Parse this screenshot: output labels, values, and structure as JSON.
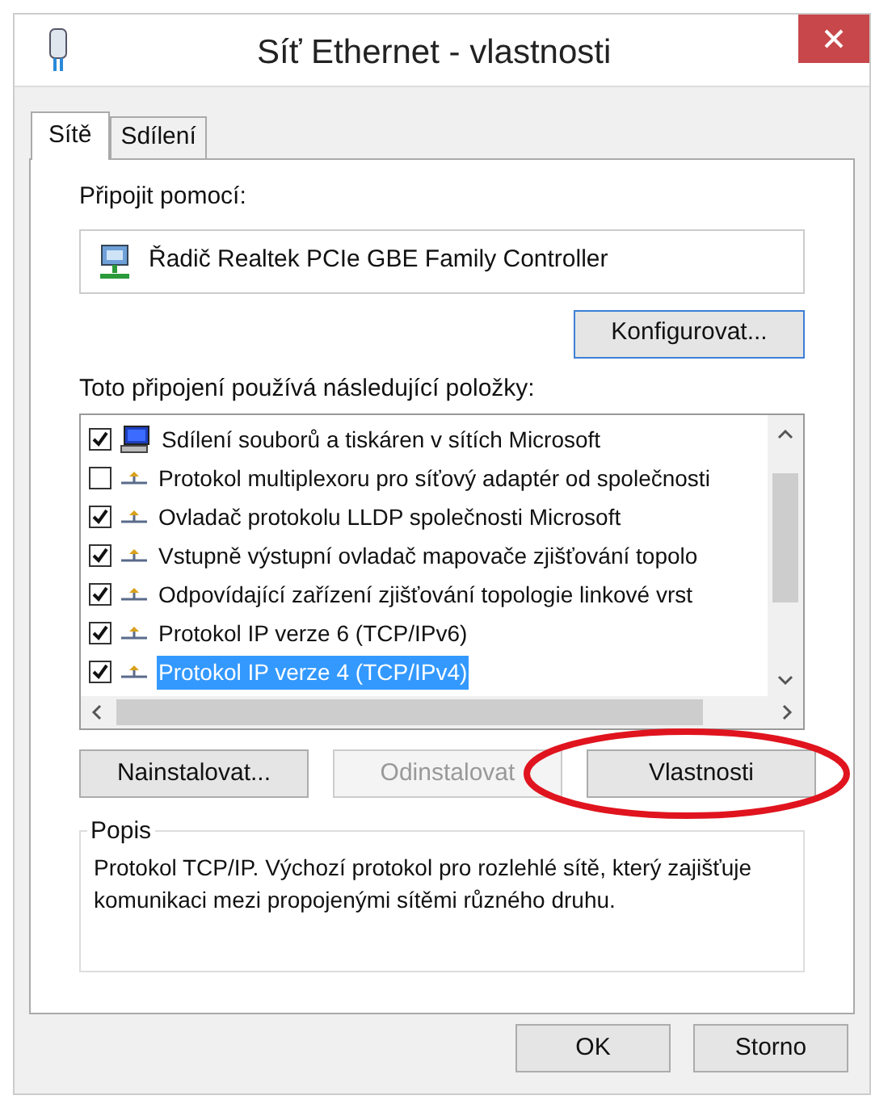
{
  "window": {
    "title": "Síť Ethernet - vlastnosti"
  },
  "tabs": [
    {
      "label": "Sítě",
      "selected": true
    },
    {
      "label": "Sdílení",
      "selected": false
    }
  ],
  "connect_using": {
    "label": "Připojit pomocí:",
    "adapter": "Řadič Realtek PCIe GBE Family Controller",
    "button": "Konfigurovat..."
  },
  "items_label": "Toto připojení používá následující položky:",
  "items": [
    {
      "kind": "service",
      "label": "Sdílení souborů a tiskáren v sítích Microsoft",
      "checked": true,
      "selected": false
    },
    {
      "kind": "protocol",
      "label": "Protokol multiplexoru pro síťový adaptér od společnosti",
      "checked": false,
      "selected": false
    },
    {
      "kind": "protocol",
      "label": "Ovladač protokolu LLDP společnosti Microsoft",
      "checked": true,
      "selected": false
    },
    {
      "kind": "protocol",
      "label": "Vstupně výstupní ovladač mapovače zjišťování topolo",
      "checked": true,
      "selected": false
    },
    {
      "kind": "protocol",
      "label": "Odpovídající zařízení zjišťování topologie linkové vrst",
      "checked": true,
      "selected": false
    },
    {
      "kind": "protocol",
      "label": "Protokol IP verze 6 (TCP/IPv6)",
      "checked": true,
      "selected": false
    },
    {
      "kind": "protocol",
      "label": "Protokol IP verze 4 (TCP/IPv4)",
      "checked": true,
      "selected": true
    }
  ],
  "item_buttons": [
    {
      "label": "Nainstalovat...",
      "disabled": false,
      "circled": false
    },
    {
      "label": "Odinstalovat",
      "disabled": true,
      "circled": false
    },
    {
      "label": "Vlastnosti",
      "disabled": false,
      "circled": true
    }
  ],
  "description": {
    "title": "Popis",
    "text": "Protokol TCP/IP. Výchozí protokol pro rozlehlé sítě, který zajišťuje komunikaci mezi propojenými sítěmi různého druhu."
  },
  "buttons": [
    "OK",
    "Storno"
  ]
}
